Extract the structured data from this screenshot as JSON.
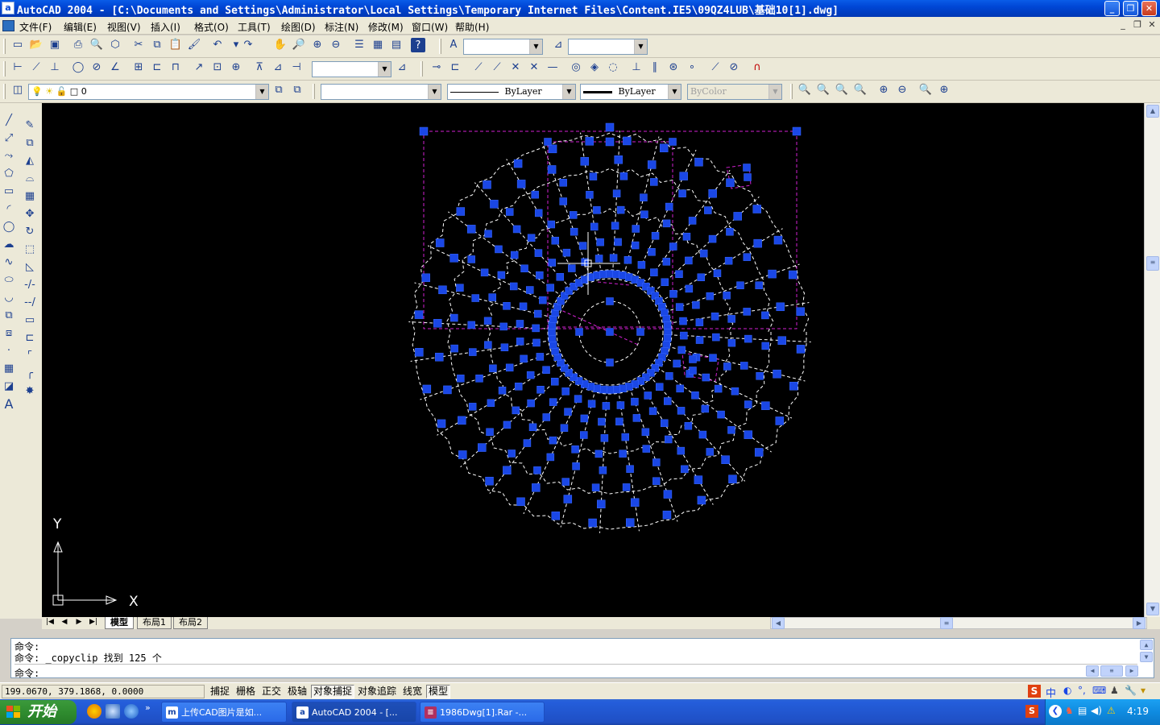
{
  "window": {
    "title": "AutoCAD 2004 - [C:\\Documents and Settings\\Administrator\\Local Settings\\Temporary Internet Files\\Content.IE5\\09QZ4LUB\\基础10[1].dwg]"
  },
  "menu": {
    "items": [
      "文件(F)",
      "编辑(E)",
      "视图(V)",
      "插入(I)",
      "格式(O)",
      "工具(T)",
      "绘图(D)",
      "标注(N)",
      "修改(M)",
      "窗口(W)",
      "帮助(H)"
    ]
  },
  "properties_toolbar": {
    "layer": "0",
    "linetype": "ByLayer",
    "lineweight": "ByLayer",
    "plotstyle": "ByColor"
  },
  "layout_tabs": [
    "模型",
    "布局1",
    "布局2"
  ],
  "command_line": {
    "lines": [
      "命令:",
      "命令: _copyclip 找到 125 个",
      "命令:"
    ]
  },
  "status": {
    "coords": "199.0670, 379.1868, 0.0000",
    "buttons": [
      {
        "label": "捕捉",
        "on": false
      },
      {
        "label": "栅格",
        "on": false
      },
      {
        "label": "正交",
        "on": false
      },
      {
        "label": "极轴",
        "on": false
      },
      {
        "label": "对象捕捉",
        "on": true
      },
      {
        "label": "对象追踪",
        "on": false
      },
      {
        "label": "线宽",
        "on": false
      },
      {
        "label": "模型",
        "on": true
      }
    ]
  },
  "ucs": {
    "x_label": "X",
    "y_label": "Y"
  },
  "taskbar": {
    "start": "开始",
    "tasks": [
      {
        "label": "上传CAD图片是如...",
        "active": false
      },
      {
        "label": "AutoCAD 2004 - [...",
        "active": true
      },
      {
        "label": "1986Dwg[1].Rar -...",
        "active": false
      }
    ],
    "clock": "4:19",
    "ime": "中"
  },
  "colors": {
    "grip": "#1a47e6",
    "selection_box": "#d020d0",
    "canvas": "#000000"
  }
}
